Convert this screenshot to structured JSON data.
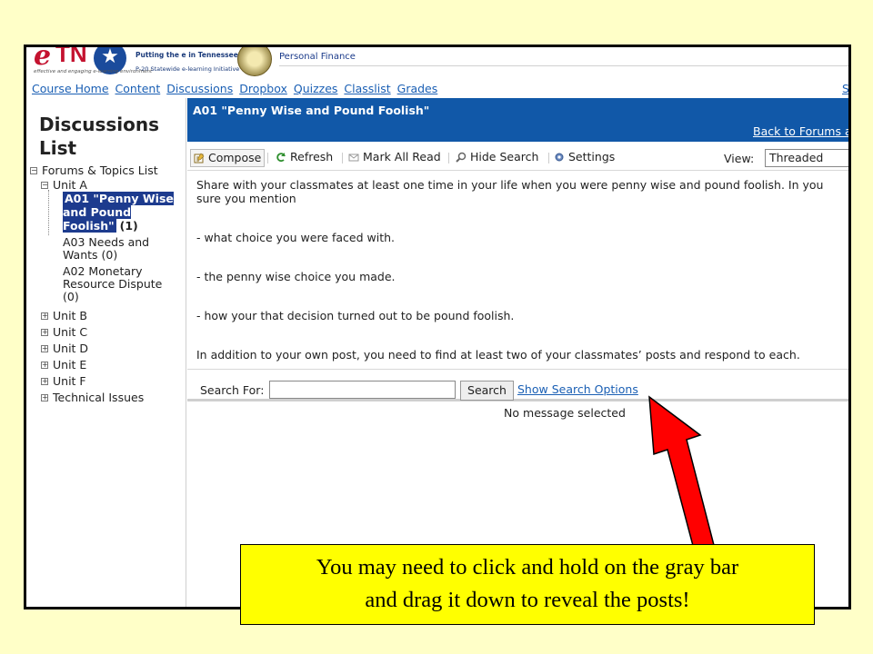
{
  "header": {
    "logo_e": "e",
    "logo_tn": "TN",
    "logo_tagline": "Putting the e in Tennessee",
    "logo_sub": "P-20 Statewide e-learning Initiative",
    "logo_small": "effective and engaging e-learning environment",
    "course_name": "Personal Finance"
  },
  "nav": {
    "items": [
      "Course Home",
      "Content",
      "Discussions",
      "Dropbox",
      "Quizzes",
      "Classlist",
      "Grades"
    ],
    "right_fragment": "S"
  },
  "left": {
    "title": "Discussions List",
    "root": "Forums & Topics List",
    "unit_a": "Unit A",
    "topics": [
      {
        "label": "A01 \"Penny Wise and Pound Foolish\"",
        "count": "(1)"
      },
      {
        "label": "A03 Needs and Wants",
        "count": "(0)"
      },
      {
        "label": "A02 Monetary Resource Dispute",
        "count": "(0)"
      }
    ],
    "units": [
      "Unit B",
      "Unit C",
      "Unit D",
      "Unit E",
      "Unit F",
      "Technical Issues"
    ]
  },
  "main": {
    "topic_title": "A01 \"Penny Wise and Pound Foolish\"",
    "back_link": "Back to Forums a",
    "toolbar": {
      "compose": "Compose",
      "refresh": "Refresh",
      "mark_all_read": "Mark All Read",
      "hide_search": "Hide Search",
      "settings": "Settings",
      "view_label": "View:",
      "view_value": "Threaded"
    },
    "description": [
      "Share with your classmates at least one time in your life when you were penny wise and pound foolish. In you",
      "sure you mention",
      "- what choice you were faced with.",
      "- the penny wise choice you made.",
      "- how your that decision turned out to be pound foolish.",
      "In addition to your own post, you need to find at least two of your classmates’ posts and respond to each."
    ],
    "search": {
      "label": "Search For:",
      "value": "",
      "button": "Search",
      "options_link": "Show Search Options"
    },
    "no_message": "No message selected"
  },
  "annotation": {
    "callout_line1": "You may need to click and hold on the gray bar",
    "callout_line2": "and drag it down to reveal the posts!",
    "arrow_color": "#ff0000"
  },
  "colors": {
    "background": "#ffffc8",
    "topic_bar": "#1158a8",
    "selection": "#1d3b8e",
    "link": "#1a5fb4",
    "callout": "#ffff00"
  }
}
